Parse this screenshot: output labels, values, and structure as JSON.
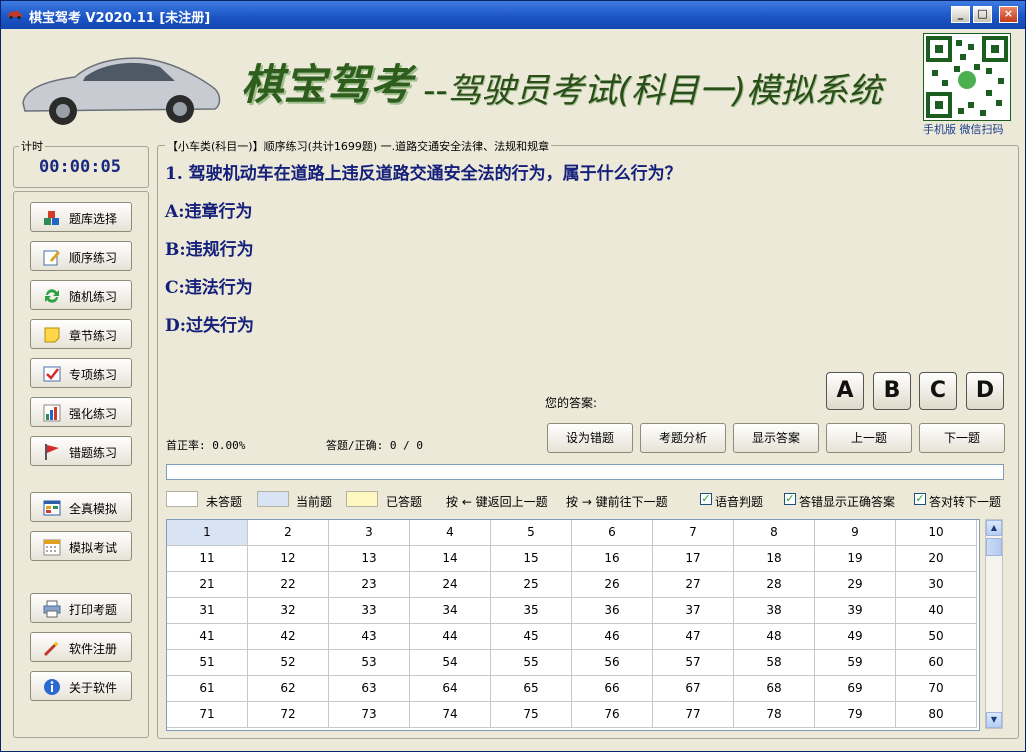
{
  "window": {
    "title": "棋宝驾考 V2020.11 [未注册]"
  },
  "banner": {
    "brand": "棋宝驾考",
    "subtitle": "--驾驶员考试(科目一)模拟系统",
    "qr_caption": "手机版 微信扫码"
  },
  "timer": {
    "label": "计时",
    "value": "00:00:05"
  },
  "sidebar": {
    "items": [
      {
        "label": "题库选择",
        "icon": "cubes-icon"
      },
      {
        "label": "顺序练习",
        "icon": "pencil-icon"
      },
      {
        "label": "随机练习",
        "icon": "refresh-icon"
      },
      {
        "label": "章节练习",
        "icon": "note-icon"
      },
      {
        "label": "专项练习",
        "icon": "checkmark-icon"
      },
      {
        "label": "强化练习",
        "icon": "bar-chart-icon"
      },
      {
        "label": "错题练习",
        "icon": "flag-icon"
      },
      {
        "label": "全真模拟",
        "icon": "window-icon"
      },
      {
        "label": "模拟考试",
        "icon": "calendar-icon"
      },
      {
        "label": "打印考题",
        "icon": "printer-icon"
      },
      {
        "label": "软件注册",
        "icon": "wand-icon"
      },
      {
        "label": "关于软件",
        "icon": "info-icon"
      }
    ]
  },
  "question": {
    "breadcrumb": "【小车类(科目一)】顺序练习(共计1699题) 一.道路交通安全法律、法规和规章",
    "text": "1. 驾驶机动车在道路上违反道路交通安全法的行为，属于什么行为？",
    "options": [
      "A:违章行为",
      "B:违规行为",
      "C:违法行为",
      "D:过失行为"
    ]
  },
  "answer": {
    "label": "您的答案:",
    "choices": [
      "A",
      "B",
      "C",
      "D"
    ]
  },
  "stats": {
    "first_correct": "首正率: 0.00%",
    "answered": "答题/正确: 0 / 0"
  },
  "actions": [
    "设为错题",
    "考题分析",
    "显示答案",
    "上一题",
    "下一题"
  ],
  "progress": {
    "fraction": 0
  },
  "legend": {
    "unanswered": "未答题",
    "current": "当前题",
    "answered": "已答题",
    "hint_prev": "按 ← 键返回上一题",
    "hint_next": "按 → 键前往下一题",
    "colors": {
      "unanswered": "#ffffff",
      "current": "#d8e4f4",
      "answered": "#fff7c0"
    }
  },
  "options_checks": [
    {
      "label": "语音判题",
      "checked": true
    },
    {
      "label": "答错显示正确答案",
      "checked": true
    },
    {
      "label": "答对转下一题",
      "checked": true
    }
  ],
  "grid": {
    "rows": [
      [
        "1",
        "2",
        "3",
        "4",
        "5",
        "6",
        "7",
        "8",
        "9",
        "10"
      ],
      [
        "11",
        "12",
        "13",
        "14",
        "15",
        "16",
        "17",
        "18",
        "19",
        "20"
      ],
      [
        "21",
        "22",
        "23",
        "24",
        "25",
        "26",
        "27",
        "28",
        "29",
        "30"
      ],
      [
        "31",
        "32",
        "33",
        "34",
        "35",
        "36",
        "37",
        "38",
        "39",
        "40"
      ],
      [
        "41",
        "42",
        "43",
        "44",
        "45",
        "46",
        "47",
        "48",
        "49",
        "50"
      ],
      [
        "51",
        "52",
        "53",
        "54",
        "55",
        "56",
        "57",
        "58",
        "59",
        "60"
      ],
      [
        "61",
        "62",
        "63",
        "64",
        "65",
        "66",
        "67",
        "68",
        "69",
        "70"
      ],
      [
        "71",
        "72",
        "73",
        "74",
        "75",
        "76",
        "77",
        "78",
        "79",
        "80"
      ]
    ],
    "current": "1"
  }
}
